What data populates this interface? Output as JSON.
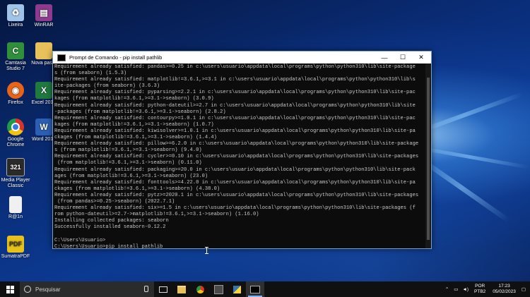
{
  "desktop_icons": [
    {
      "id": "lixeira",
      "label": "Lixeira",
      "icon": "recycle-bin-icon",
      "color": "#9fc4e8"
    },
    {
      "id": "winrar",
      "label": "WinRAR",
      "icon": "winrar-icon",
      "color": "#8e3a8e"
    },
    {
      "id": "camtasia",
      "label": "Camtasia Studio 7",
      "icon": "camtasia-icon",
      "color": "#2f8f3a"
    },
    {
      "id": "nova-pasta",
      "label": "Nova pasta",
      "icon": "folder-icon",
      "color": "#e8c15a"
    },
    {
      "id": "firefox",
      "label": "Firefox",
      "icon": "firefox-icon",
      "color": "#e8641a"
    },
    {
      "id": "excel",
      "label": "Excel 2016",
      "icon": "excel-icon",
      "color": "#1f7a40"
    },
    {
      "id": "chrome",
      "label": "Google Chrome",
      "icon": "chrome-icon",
      "color": "#d8352a"
    },
    {
      "id": "word",
      "label": "Word 2016",
      "icon": "word-icon",
      "color": "#2b5fb4"
    },
    {
      "id": "media-player",
      "label": "Media Player Classic",
      "icon": "media-player-icon",
      "color": "#2a2a2a"
    },
    {
      "id": "r1n",
      "label": "R@1n",
      "icon": "document-icon",
      "color": "#f0f0f0"
    },
    {
      "id": "sumatra",
      "label": "SumatraPDF",
      "icon": "sumatrapdf-icon",
      "color": "#e8c21a"
    }
  ],
  "window": {
    "title": "Prompt de Comando - pip  install pathlib",
    "minimize": "—",
    "maximize": "☐",
    "close": "✕"
  },
  "console_lines": [
    "Requirement already satisfied: pandas>=0.25 in c:\\users\\usuario\\appdata\\local\\programs\\python\\python310\\lib\\site-package",
    "s (from seaborn) (1.5.3)",
    "Requirement already satisfied: matplotlib!=3.6.1,>=3.1 in c:\\users\\usuario\\appdata\\local\\programs\\python\\python310\\lib\\s",
    "ite-packages (from seaborn) (3.6.3)",
    "Requirement already satisfied: pyparsing>=2.2.1 in c:\\users\\usuario\\appdata\\local\\programs\\python\\python310\\lib\\site-pac",
    "kages (from matplotlib!=3.6.1,>=3.1->seaborn) (3.0.9)",
    "Requirement already satisfied: python-dateutil>=2.7 in c:\\users\\usuario\\appdata\\local\\programs\\python\\python310\\lib\\site",
    "-packages (from matplotlib!=3.6.1,>=3.1->seaborn) (2.8.2)",
    "Requirement already satisfied: contourpy>=1.0.1 in c:\\users\\usuario\\appdata\\local\\programs\\python\\python310\\lib\\site-pac",
    "kages (from matplotlib!=3.6.1,>=3.1->seaborn) (1.0.7)",
    "Requirement already satisfied: kiwisolver>=1.0.1 in c:\\users\\usuario\\appdata\\local\\programs\\python\\python310\\lib\\site-pa",
    "ckages (from matplotlib!=3.6.1,>=3.1->seaborn) (1.4.4)",
    "Requirement already satisfied: pillow>=6.2.0 in c:\\users\\usuario\\appdata\\local\\programs\\python\\python310\\lib\\site-package",
    "s (from matplotlib!=3.6.1,>=3.1->seaborn) (9.4.0)",
    "Requirement already satisfied: cycler>=0.10 in c:\\users\\usuario\\appdata\\local\\programs\\python\\python310\\lib\\site-packages",
    " (from matplotlib!=3.6.1,>=3.1->seaborn) (0.11.0)",
    "Requirement already satisfied: packaging>=20.0 in c:\\users\\usuario\\appdata\\local\\programs\\python\\python310\\lib\\site-pack",
    "ages (from matplotlib!=3.6.1,>=3.1->seaborn) (23.0)",
    "Requirement already satisfied: fonttools>=4.22.0 in c:\\users\\usuario\\appdata\\local\\programs\\python\\python310\\lib\\site-pa",
    "ckages (from matplotlib!=3.6.1,>=3.1->seaborn) (4.38.0)",
    "Requirement already satisfied: pytz>=2020.1 in c:\\users\\usuario\\appdata\\local\\programs\\python\\python310\\lib\\site-packages",
    " (from pandas>=0.25->seaborn) (2022.7.1)",
    "Requirement already satisfied: six>=1.5 in c:\\users\\usuario\\appdata\\local\\programs\\python\\python310\\lib\\site-packages (f",
    "rom python-dateutil>=2.7->matplotlib!=3.6.1,>=3.1->seaborn) (1.16.0)",
    "Installing collected packages: seaborn",
    "Successfully installed seaborn-0.12.2",
    "",
    "C:\\Users\\Usuario>",
    "C:\\Users\\Usuario>pip install pathlib"
  ],
  "taskbar": {
    "search_placeholder": "Pesquisar",
    "apps": [
      {
        "id": "task-view",
        "icon": "task-view-icon",
        "active": false
      },
      {
        "id": "file-explorer",
        "icon": "file-explorer-icon",
        "active": false
      },
      {
        "id": "chrome",
        "icon": "chrome-icon",
        "active": false
      },
      {
        "id": "app-generic",
        "icon": "app-icon",
        "active": false
      },
      {
        "id": "app-terminal-bg",
        "icon": "python-icon",
        "active": false
      },
      {
        "id": "cmd",
        "icon": "cmd-icon",
        "active": true
      }
    ],
    "lang_top": "POR",
    "lang_bottom": "PTB2",
    "time": "17:23",
    "date": "05/02/2023"
  }
}
